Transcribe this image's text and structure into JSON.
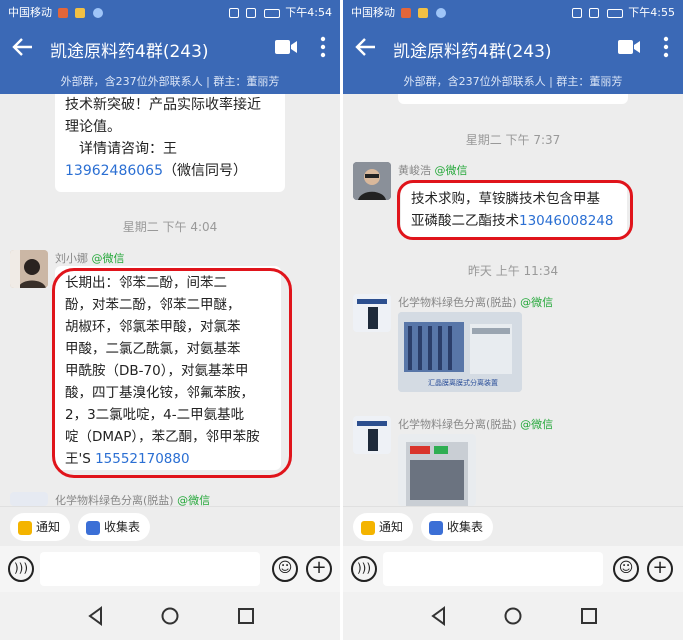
{
  "left": {
    "status": {
      "carrier": "中国移动",
      "time": "下午4:54"
    },
    "header": {
      "title": "凯途原料药4群(243)",
      "subtitle": "外部群，含237位外部联系人 | 群主：董丽芳"
    },
    "top_bubble": {
      "lines": [
        "技术新突破！产品实际收率接近",
        "理论值。",
        "详情请咨询：王"
      ],
      "phone": "13962486065",
      "after_phone": "（微信同号）"
    },
    "time_separator": "星期二 下午 4:04",
    "message": {
      "sender": "刘小娜",
      "sender_tag": "@微信",
      "lines": [
        "长期出：邻苯二酚，间苯二",
        "酚，对苯二酚，邻苯二甲醚，",
        "胡椒环，邻氯苯甲酸，对氯苯",
        "甲酸，二氯乙酰氯，对氨基苯",
        "甲酰胺（DB-70），对氨基苯甲",
        "酸，四丁基溴化铵，邻氟苯胺，",
        "2，3二氯吡啶，4-二甲氨基吡",
        "啶（DMAP），苯乙酮，邻甲苯胺"
      ],
      "last_prefix": "王'S ",
      "phone": "15552170880"
    },
    "partial_sender": "化学物料绿色分离(脱盐)",
    "partial_tag": "@微信",
    "toolbar": {
      "notify": "通知",
      "form": "收集表"
    }
  },
  "right": {
    "status": {
      "carrier": "中国移动",
      "time": "下午4:55"
    },
    "header": {
      "title": "凯途原料药4群(243)",
      "subtitle": "外部群，含237位外部联系人 | 群主：董丽芳"
    },
    "time_separator_1": "星期二 下午 7:37",
    "message": {
      "sender": "黄峻浩",
      "sender_tag": "@微信",
      "line1": "技术求购，草铵膦技术包含甲基",
      "line2_prefix": "亚磷酸二乙酯技术",
      "phone": "13046008248"
    },
    "time_separator_2": "昨天 上午 11:34",
    "image_msg_1": {
      "sender": "化学物料绿色分离(脱盐)",
      "sender_tag": "@微信",
      "caption": "汇晶膜离膜式分离装置"
    },
    "image_msg_2": {
      "sender": "化学物料绿色分离(脱盐)",
      "sender_tag": "@微信"
    },
    "toolbar": {
      "notify": "通知",
      "form": "收集表"
    }
  },
  "colors": {
    "header": "#3b69b6",
    "link": "#2b6fd3",
    "annotation": "#e0141b",
    "wechat_tag": "#25a83a",
    "chat_bg": "#ededed"
  },
  "icons": [
    "back-arrow-icon",
    "video-call-icon",
    "more-icon",
    "megaphone-icon",
    "form-icon",
    "voice-icon",
    "emoji-icon",
    "plus-icon",
    "nav-back-icon",
    "nav-home-icon",
    "nav-recents-icon"
  ]
}
